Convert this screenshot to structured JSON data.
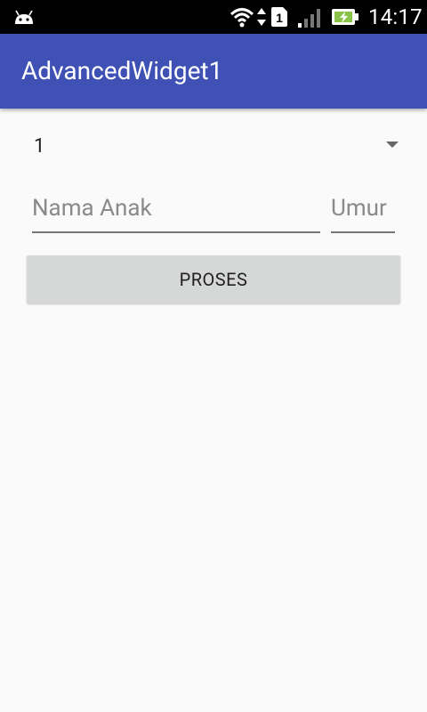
{
  "status_bar": {
    "time": "14:17",
    "sim_number": "1",
    "icons": [
      "android-icon",
      "wifi-icon",
      "data-arrows-icon",
      "sim-card-icon",
      "signal-icon",
      "battery-charging-icon"
    ]
  },
  "app_bar": {
    "title": "AdvancedWidget1",
    "color": "#3f51b5"
  },
  "form": {
    "spinner_value": "1",
    "nama_placeholder": "Nama Anak",
    "umur_placeholder": "Umur",
    "proses_label": "PROSES"
  }
}
